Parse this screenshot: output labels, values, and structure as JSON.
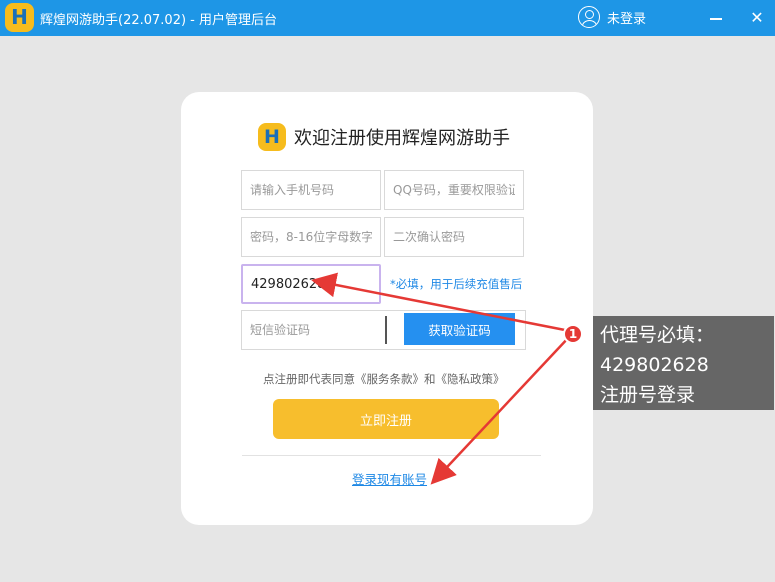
{
  "window": {
    "title": "辉煌网游助手(22.07.02) - 用户管理后台",
    "logo_letter": "H",
    "user_label": "未登录",
    "minimize_icon": "minimize-icon",
    "close_label": "✕"
  },
  "form": {
    "brand_letter": "H",
    "heading": "欢迎注册使用辉煌网游助手",
    "phone_placeholder": "请输入手机号码",
    "qq_placeholder": "QQ号码，重要权限验证",
    "password_placeholder": "密码，8-16位字母数字",
    "confirm_placeholder": "二次确认密码",
    "agent_value": "429802628",
    "agent_hint": "*必填，用于后续充值售后",
    "sms_placeholder": "短信验证码",
    "sms_button": "获取验证码",
    "agreement": "点注册即代表同意《服务条款》和《隐私政策》",
    "register_button": "立即注册",
    "login_link": "登录现有账号"
  },
  "annotation": {
    "badge_number": "1",
    "lines": [
      "代理号必填：",
      "429802628",
      "注册号登录"
    ],
    "arrow_color": "#e53935"
  },
  "colors": {
    "titlebar": "#1e96e6",
    "primary_button": "#2590f0",
    "register_button": "#f7be2d",
    "link": "#1e88e5"
  }
}
